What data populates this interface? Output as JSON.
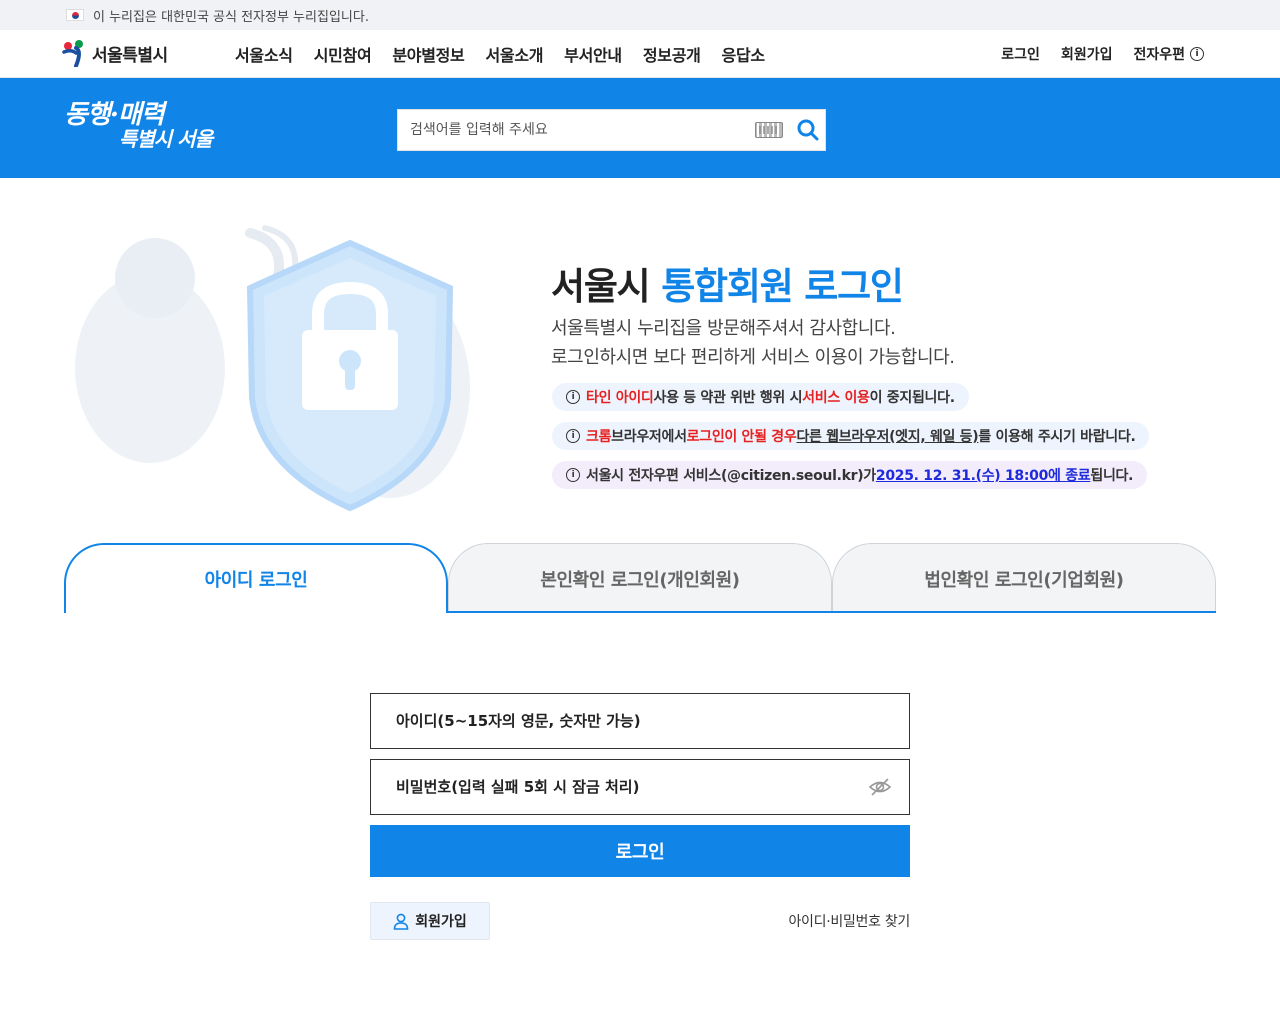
{
  "gov_banner": {
    "text": "이 누리집은 대한민국 공식 전자정부 누리집입니다."
  },
  "header": {
    "logo_text": "서울특별시",
    "menu": [
      "서울소식",
      "시민참여",
      "분야별정보",
      "서울소개",
      "부서안내",
      "정보공개",
      "응답소"
    ],
    "util": {
      "login": "로그인",
      "signup": "회원가입",
      "email": "전자우편"
    },
    "slogan_line1": "동행·매력",
    "slogan_line2": "특별시 서울",
    "search_placeholder": "검색어를 입력해 주세요"
  },
  "hero": {
    "title_plain": "서울시 ",
    "title_accent": "통합회원 로그인",
    "desc_line1": "서울특별시 누리집을 방문해주셔서 감사합니다.",
    "desc_line2": "로그인하시면 보다 편리하게 서비스 이용이 가능합니다."
  },
  "notices": {
    "n1": {
      "red1": "타인 아이디",
      "t1": " 사용 등 약관 위반 행위 시 ",
      "red2": "서비스 이용",
      "t2": "이 중지됩니다."
    },
    "n2": {
      "red1": "크롬",
      "t1": " 브라우저에서 ",
      "red2": "로그인이 안될 경우",
      "t2": " ",
      "ul": "다른 웹브라우저(엣지, 웨일 등)",
      "t3": "를 이용해 주시기 바랍니다."
    },
    "n3": {
      "t1": "서울시 전자우편 서비스(@citizen.seoul.kr)가 ",
      "link": "2025. 12. 31.(수) 18:00에 종료",
      "t2": "됩니다."
    }
  },
  "tabs": [
    "아이디 로그인",
    "본인확인 로그인(개인회원)",
    "법인확인 로그인(기업회원)"
  ],
  "form": {
    "id_placeholder": "아이디(5~15자의 영문, 숫자만 가능)",
    "pw_placeholder": "비밀번호(입력 실패 5회 시 잠금 처리)",
    "login_label": "로그인",
    "join_label": "회원가입",
    "find_label": "아이디·비밀번호 찾기"
  },
  "colors": {
    "primary": "#1184e8",
    "alert_red": "#e62121",
    "link_blue": "#1e2adc"
  }
}
